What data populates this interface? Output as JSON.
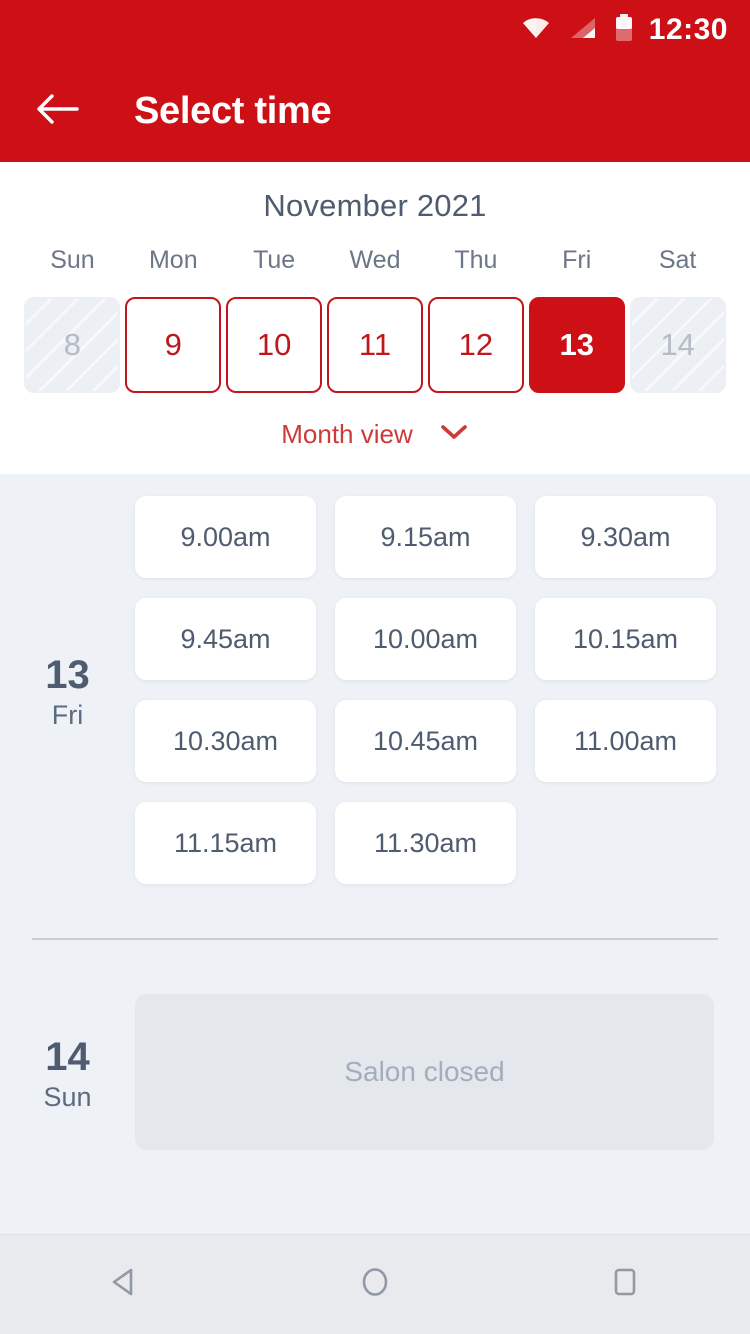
{
  "status_bar": {
    "time": "12:30",
    "icons": [
      "wifi-icon",
      "signal-icon",
      "battery-icon"
    ]
  },
  "app_bar": {
    "back_icon": "arrow-left-icon",
    "title": "Select time",
    "background_color": "#cc1016"
  },
  "calendar": {
    "month_title": "November 2021",
    "weekdays": [
      "Sun",
      "Mon",
      "Tue",
      "Wed",
      "Thu",
      "Fri",
      "Sat"
    ],
    "dates": [
      {
        "day": "8",
        "state": "disabled"
      },
      {
        "day": "9",
        "state": "available"
      },
      {
        "day": "10",
        "state": "available"
      },
      {
        "day": "11",
        "state": "available"
      },
      {
        "day": "12",
        "state": "available"
      },
      {
        "day": "13",
        "state": "selected"
      },
      {
        "day": "14",
        "state": "disabled"
      }
    ],
    "month_view_label": "Month view",
    "month_view_icon": "chevron-down-icon",
    "accent_color": "#cc1016"
  },
  "schedule": {
    "days": [
      {
        "day_number": "13",
        "day_of_week": "Fri",
        "slots": [
          "9.00am",
          "9.15am",
          "9.30am",
          "9.45am",
          "10.00am",
          "10.15am",
          "10.30am",
          "10.45am",
          "11.00am",
          "11.15am",
          "11.30am"
        ],
        "closed_message": null
      },
      {
        "day_number": "14",
        "day_of_week": "Sun",
        "slots": [],
        "closed_message": "Salon closed"
      }
    ]
  },
  "nav_bar": {
    "buttons": [
      "back-nav-icon",
      "home-nav-icon",
      "recents-nav-icon"
    ]
  }
}
